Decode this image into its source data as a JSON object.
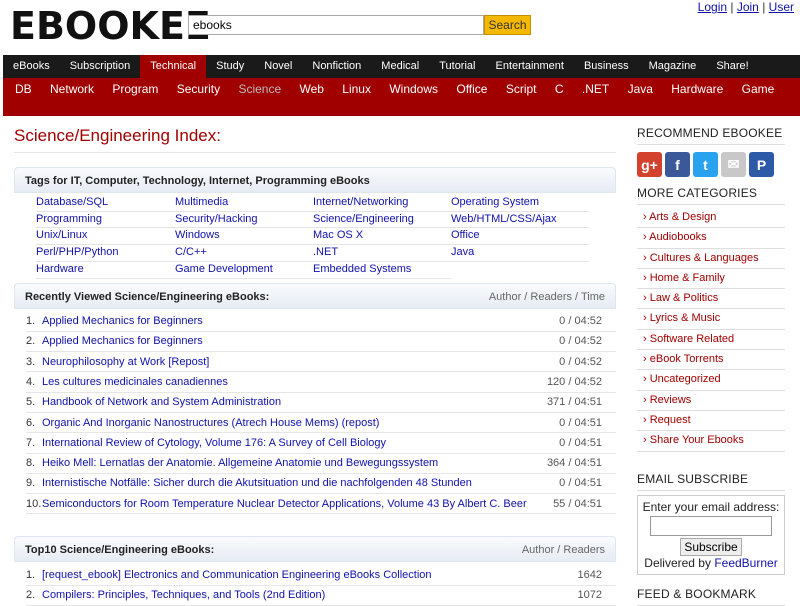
{
  "header": {
    "logo": "EBOOKEE",
    "search_value": "ebooks",
    "search_button": "Search",
    "links": [
      "Login",
      "Join",
      "User"
    ]
  },
  "nav_main": [
    "eBooks",
    "Subscription",
    "Technical",
    "Study",
    "Novel",
    "Nonfiction",
    "Medical",
    "Tutorial",
    "Entertainment",
    "Business",
    "Magazine",
    "Share!"
  ],
  "nav_sub": [
    "DB",
    "Network",
    "Program",
    "Security",
    "Science",
    "Web",
    "Linux",
    "Windows",
    "Office",
    "Script",
    "C",
    ".NET",
    "Java",
    "Hardware",
    "Game"
  ],
  "page_title": "Science/Engineering Index:",
  "tags": {
    "heading": "Tags for IT, Computer, Technology, Internet, Programming eBooks",
    "items": [
      "Database/SQL",
      "Multimedia",
      "Internet/Networking",
      "Operating System",
      "Programming",
      "Security/Hacking",
      "Science/Engineering",
      "Web/HTML/CSS/Ajax",
      "Unix/Linux",
      "Windows",
      "Mac OS X",
      "Office",
      "Perl/PHP/Python",
      "C/C++",
      ".NET",
      "Java",
      "Hardware",
      "Game Development",
      "Embedded Systems"
    ]
  },
  "recent": {
    "heading": "Recently Viewed Science/Engineering eBooks:",
    "meta_heading": "Author / Readers / Time",
    "rows": [
      {
        "n": "1.",
        "title": "Applied Mechanics for Beginners",
        "meta": "0 / 04:52"
      },
      {
        "n": "2.",
        "title": "Applied Mechanics for Beginners",
        "meta": "0 / 04:52"
      },
      {
        "n": "3.",
        "title": "Neurophilosophy at Work [Repost]",
        "meta": "0 / 04:52"
      },
      {
        "n": "4.",
        "title": "Les cultures medicinales canadiennes",
        "meta": "120 / 04:52"
      },
      {
        "n": "5.",
        "title": "Handbook of Network and System Administration",
        "meta": "371 / 04:51"
      },
      {
        "n": "6.",
        "title": "Organic And Inorganic Nanostructures (Atrech House Mems) (repost)",
        "meta": "0 / 04:51"
      },
      {
        "n": "7.",
        "title": "International Review of Cytology, Volume 176: A Survey of Cell Biology",
        "meta": "0 / 04:51"
      },
      {
        "n": "8.",
        "title": "Heiko Mell: Lernatlas der Anatomie. Allgemeine Anatomie und Bewegungssystem",
        "meta": "364 / 04:51"
      },
      {
        "n": "9.",
        "title": "Internistische Notfälle: Sicher durch die Akutsituation und die nachfolgenden 48 Stunden",
        "meta": "0 / 04:51"
      },
      {
        "n": "10.",
        "title": "Semiconductors for Room Temperature Nuclear Detector Applications, Volume 43 By Albert C. Beer",
        "meta": "55 / 04:51"
      }
    ]
  },
  "top10": {
    "heading": "Top10 Science/Engineering eBooks:",
    "meta_heading": "Author / Readers",
    "rows": [
      {
        "n": "1.",
        "title": "[request_ebook] Electronics and Communication Engineering eBooks Collection",
        "meta": "1642"
      },
      {
        "n": "2.",
        "title": "Compilers: Principles, Techniques, and Tools (2nd Edition)",
        "meta": "1072"
      }
    ]
  },
  "sidebar": {
    "recommend_title": "RECOMMEND EBOOKEE",
    "social": [
      {
        "name": "google-plus-icon",
        "glyph": "g+",
        "color": "#d2422d"
      },
      {
        "name": "facebook-icon",
        "glyph": "f",
        "color": "#3b5998"
      },
      {
        "name": "twitter-icon",
        "glyph": "t",
        "color": "#2aa3ef"
      },
      {
        "name": "email-icon",
        "glyph": "✉",
        "color": "#c8c8c8"
      },
      {
        "name": "pinboard-icon",
        "glyph": "P",
        "color": "#2d5aa6"
      }
    ],
    "more_title": "MORE CATEGORIES",
    "categories": [
      "Arts & Design",
      "Audiobooks",
      "Cultures & Languages",
      "Home & Family",
      "Law & Politics",
      "Lyrics & Music",
      "Software Related",
      "eBook Torrents",
      "Uncategorized",
      "Reviews",
      "Request",
      "Share Your Ebooks"
    ],
    "email_title": "EMAIL SUBSCRIBE",
    "email_prompt": "Enter your email address:",
    "subscribe_button": "Subscribe",
    "delivered_by": "Delivered by",
    "feedburner": "FeedBurner",
    "feed_title": "FEED & BOOKMARK"
  }
}
